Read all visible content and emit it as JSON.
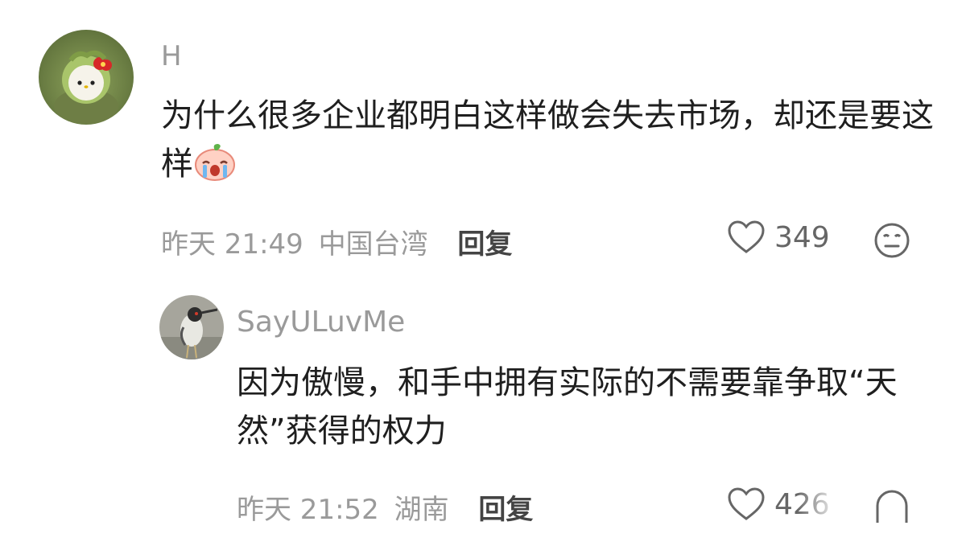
{
  "comments": [
    {
      "username": "H",
      "text": "为什么很多企业都明白这样做会失去市场，却还是要这样",
      "time": "昨天 21:49",
      "location": "中国台湾",
      "reply_label": "回复",
      "likes": "349",
      "reaction_icon": "neutral-face-icon",
      "inline_emoji": "crying-peach-emoji"
    },
    {
      "username": "SayULuvMe",
      "text": "因为傲慢，和手中拥有实际的不需要靠争取“天然”获得的权力",
      "time": "昨天 21:52",
      "location": "湖南",
      "reply_label": "回复",
      "likes": "426",
      "reaction_icon": "face-icon"
    }
  ]
}
